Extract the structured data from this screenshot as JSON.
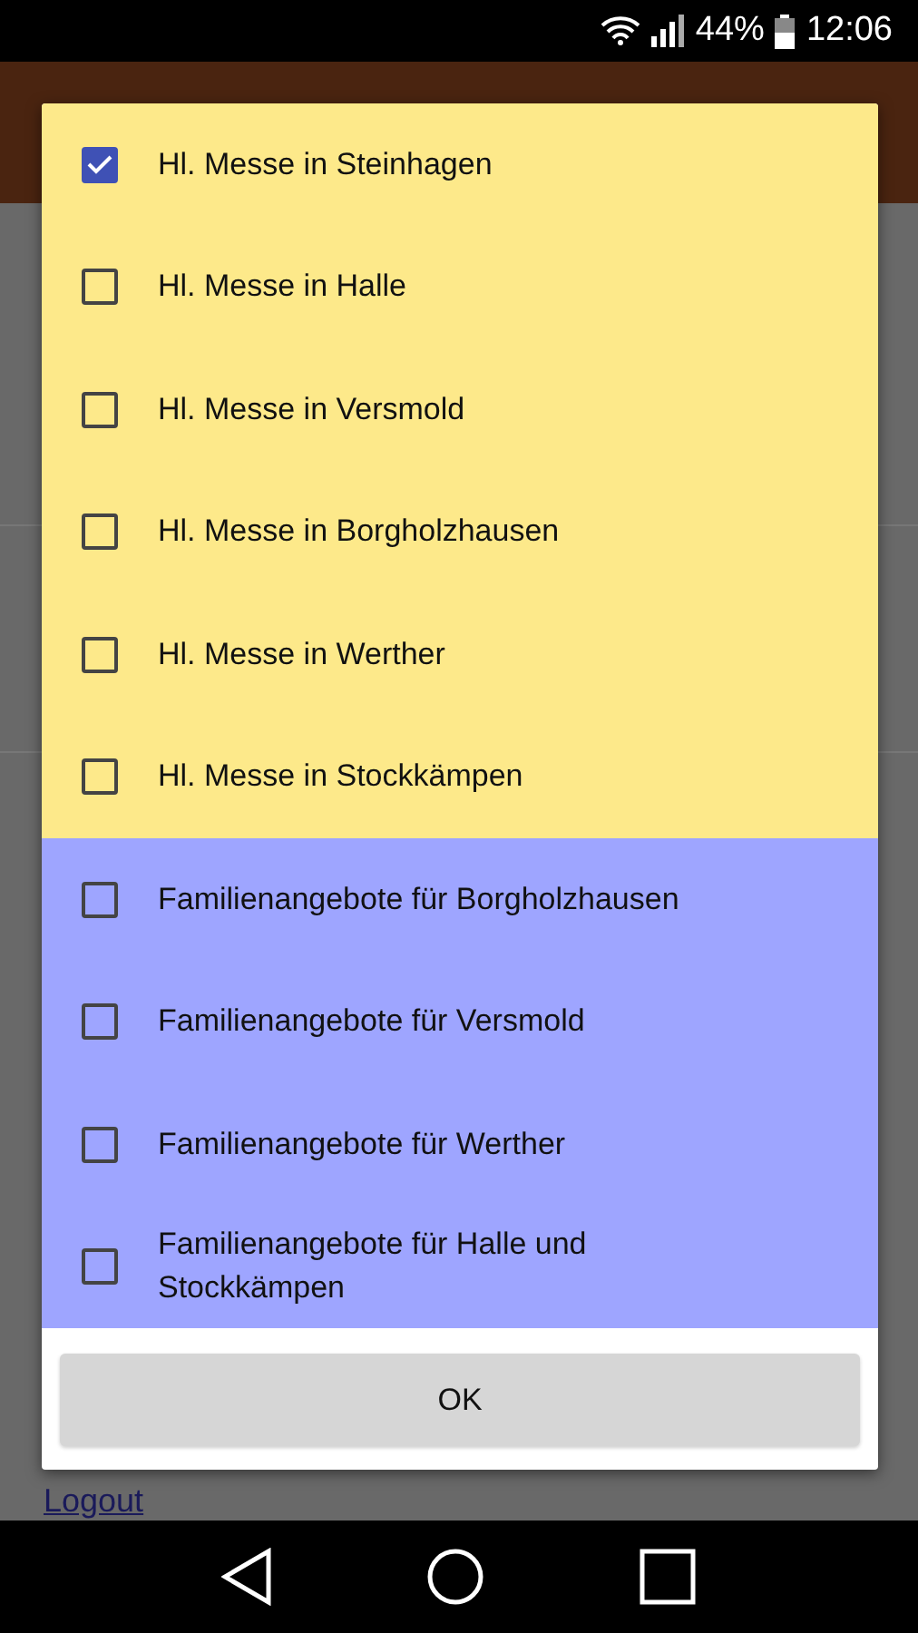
{
  "status_bar": {
    "battery": "44%",
    "time": "12:06"
  },
  "background": {
    "link": "Logout"
  },
  "dialog": {
    "options": [
      {
        "label": "Hl. Messe in Steinhagen",
        "checked": true,
        "color": "#fde98a"
      },
      {
        "label": "Hl. Messe in Halle",
        "checked": false,
        "color": "#fde98a"
      },
      {
        "label": "Hl. Messe in Versmold",
        "checked": false,
        "color": "#fde98a"
      },
      {
        "label": "Hl. Messe in Borgholzhausen",
        "checked": false,
        "color": "#fde98a"
      },
      {
        "label": "Hl. Messe in Werther",
        "checked": false,
        "color": "#fde98a"
      },
      {
        "label": "Hl. Messe in Stockkämpen",
        "checked": false,
        "color": "#fde98a"
      },
      {
        "label": "Familienangebote für Borgholzhausen",
        "checked": false,
        "color": "#9ea5ff"
      },
      {
        "label": "Familienangebote für Versmold",
        "checked": false,
        "color": "#9ea5ff"
      },
      {
        "label": "Familienangebote für Werther",
        "checked": false,
        "color": "#9ea5ff"
      },
      {
        "label": "Familienangebote für Halle und Stockkämpen",
        "checked": false,
        "color": "#9ea5ff"
      }
    ],
    "button": "OK"
  }
}
